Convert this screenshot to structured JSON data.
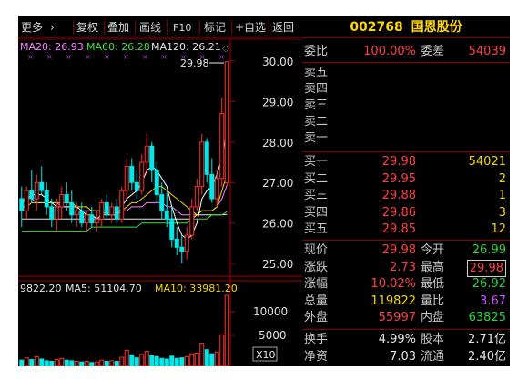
{
  "toolbar": {
    "more": "更多",
    "buttons": [
      "复权",
      "叠加",
      "画线",
      "F10",
      "标记",
      "+自选",
      "返回"
    ]
  },
  "ma_legend": [
    {
      "label": "MA20: 26.93",
      "color": "#ff80ff"
    },
    {
      "label": "MA60: 26.28",
      "color": "#3fe03f"
    },
    {
      "label": "MA120: 26.21",
      "color": "#e6e6e6"
    }
  ],
  "price_axis": [
    "30.00",
    "29.00",
    "28.00",
    "27.00",
    "26.00",
    "25.00"
  ],
  "high_marker": "29.98",
  "volume_legend": {
    "vol": "9822.20",
    "ma5": "MA5: 51104.70",
    "ma10": "MA10: 33981.20"
  },
  "volume_axis": [
    "10000",
    "5000"
  ],
  "volume_unit": "X10",
  "stock": {
    "code": "002768",
    "name": "国恩股份"
  },
  "order_ratio": {
    "label": "委比",
    "value": "100.00%",
    "label2": "委差",
    "value2": "54039"
  },
  "sell": [
    {
      "label": "卖五",
      "price": "",
      "vol": ""
    },
    {
      "label": "卖四",
      "price": "",
      "vol": ""
    },
    {
      "label": "卖三",
      "price": "",
      "vol": ""
    },
    {
      "label": "卖二",
      "price": "",
      "vol": ""
    },
    {
      "label": "卖一",
      "price": "",
      "vol": ""
    }
  ],
  "buy": [
    {
      "label": "买一",
      "price": "29.98",
      "vol": "54021"
    },
    {
      "label": "买二",
      "price": "29.95",
      "vol": "2"
    },
    {
      "label": "买三",
      "price": "29.88",
      "vol": "1"
    },
    {
      "label": "买四",
      "price": "29.86",
      "vol": "3"
    },
    {
      "label": "买五",
      "price": "29.85",
      "vol": "12"
    }
  ],
  "quote": [
    {
      "l1": "现价",
      "v1": "29.98",
      "l2": "今开",
      "v2": "26.99"
    },
    {
      "l1": "涨跌",
      "v1": "2.73",
      "l2": "最高",
      "v2": "29.98"
    },
    {
      "l1": "涨幅",
      "v1": "10.02%",
      "l2": "最低",
      "v2": "26.92"
    },
    {
      "l1": "总量",
      "v1": "119822",
      "l2": "量比",
      "v2": "3.67"
    },
    {
      "l1": "外盘",
      "v1": "55997",
      "l2": "内盘",
      "v2": "63825"
    }
  ],
  "stats": [
    {
      "l1": "换手",
      "v1": "4.99%",
      "l2": "股本",
      "v2": "2.71亿"
    },
    {
      "l1": "净资",
      "v1": "7.03",
      "l2": "流通",
      "v2": "2.40亿"
    }
  ],
  "chart_data": {
    "type": "candlestick",
    "ylim": [
      24.8,
      30.2
    ],
    "volume_ylim": [
      0,
      12000
    ],
    "candles": [
      [
        26.6,
        26.9,
        25.9,
        26.3,
        "down"
      ],
      [
        26.3,
        26.9,
        26.1,
        26.8,
        "up"
      ],
      [
        26.8,
        27.3,
        26.5,
        26.6,
        "down"
      ],
      [
        26.6,
        27.2,
        26.3,
        27.0,
        "up"
      ],
      [
        27.0,
        27.4,
        26.7,
        26.8,
        "down"
      ],
      [
        26.8,
        27.0,
        26.2,
        26.4,
        "down"
      ],
      [
        26.4,
        26.6,
        25.9,
        26.1,
        "down"
      ],
      [
        26.1,
        26.6,
        25.8,
        26.4,
        "up"
      ],
      [
        26.4,
        26.9,
        26.1,
        26.7,
        "up"
      ],
      [
        26.7,
        27.0,
        26.3,
        26.5,
        "down"
      ],
      [
        26.5,
        26.8,
        26.0,
        26.2,
        "down"
      ],
      [
        26.2,
        26.5,
        25.9,
        26.3,
        "up"
      ],
      [
        26.3,
        26.5,
        25.9,
        26.0,
        "down"
      ],
      [
        26.0,
        26.3,
        25.8,
        26.2,
        "up"
      ],
      [
        26.2,
        26.4,
        25.9,
        26.0,
        "down"
      ],
      [
        26.0,
        26.3,
        25.8,
        26.1,
        "up"
      ],
      [
        26.1,
        26.6,
        25.9,
        26.5,
        "up"
      ],
      [
        26.5,
        26.7,
        26.1,
        26.2,
        "down"
      ],
      [
        26.2,
        26.5,
        26.0,
        26.4,
        "up"
      ],
      [
        26.4,
        26.6,
        26.0,
        26.1,
        "down"
      ],
      [
        26.1,
        26.9,
        26.0,
        26.8,
        "up"
      ],
      [
        26.8,
        27.6,
        26.6,
        27.4,
        "up"
      ],
      [
        27.4,
        27.6,
        26.8,
        27.0,
        "down"
      ],
      [
        27.0,
        27.3,
        26.6,
        26.8,
        "down"
      ],
      [
        26.8,
        27.7,
        26.7,
        27.5,
        "up"
      ],
      [
        27.5,
        28.2,
        27.2,
        27.9,
        "up"
      ],
      [
        27.9,
        28.0,
        27.0,
        27.3,
        "down"
      ],
      [
        27.3,
        27.5,
        26.5,
        26.7,
        "down"
      ],
      [
        26.7,
        27.0,
        26.1,
        26.3,
        "down"
      ],
      [
        26.3,
        26.8,
        25.9,
        26.1,
        "down"
      ],
      [
        26.1,
        26.4,
        25.4,
        25.6,
        "down"
      ],
      [
        25.6,
        25.9,
        25.2,
        25.4,
        "down"
      ],
      [
        25.4,
        25.7,
        25.0,
        25.3,
        "down"
      ],
      [
        25.3,
        25.9,
        25.1,
        25.7,
        "up"
      ],
      [
        25.7,
        26.6,
        25.6,
        26.4,
        "up"
      ],
      [
        26.4,
        27.1,
        26.3,
        26.9,
        "up"
      ],
      [
        26.9,
        28.2,
        26.7,
        28.0,
        "up"
      ],
      [
        28.0,
        28.1,
        27.0,
        27.2,
        "down"
      ],
      [
        27.2,
        27.6,
        26.5,
        26.6,
        "down"
      ],
      [
        26.6,
        27.3,
        26.4,
        27.1,
        "up"
      ],
      [
        27.1,
        29.1,
        26.9,
        28.7,
        "up"
      ],
      [
        26.99,
        29.98,
        26.92,
        29.98,
        "up"
      ]
    ],
    "volumes": [
      [
        900,
        "down"
      ],
      [
        1300,
        "up"
      ],
      [
        1000,
        "down"
      ],
      [
        1500,
        "up"
      ],
      [
        1100,
        "down"
      ],
      [
        800,
        "down"
      ],
      [
        700,
        "down"
      ],
      [
        1000,
        "up"
      ],
      [
        1200,
        "up"
      ],
      [
        900,
        "down"
      ],
      [
        800,
        "down"
      ],
      [
        700,
        "up"
      ],
      [
        600,
        "down"
      ],
      [
        700,
        "up"
      ],
      [
        500,
        "down"
      ],
      [
        600,
        "up"
      ],
      [
        900,
        "up"
      ],
      [
        700,
        "down"
      ],
      [
        800,
        "up"
      ],
      [
        700,
        "down"
      ],
      [
        1400,
        "up"
      ],
      [
        2600,
        "up"
      ],
      [
        1800,
        "down"
      ],
      [
        1300,
        "down"
      ],
      [
        1900,
        "up"
      ],
      [
        2400,
        "up"
      ],
      [
        1700,
        "down"
      ],
      [
        1500,
        "down"
      ],
      [
        1200,
        "down"
      ],
      [
        1100,
        "down"
      ],
      [
        1600,
        "down"
      ],
      [
        1200,
        "down"
      ],
      [
        1300,
        "down"
      ],
      [
        1500,
        "up"
      ],
      [
        2000,
        "up"
      ],
      [
        2100,
        "up"
      ],
      [
        3800,
        "up"
      ],
      [
        2700,
        "down"
      ],
      [
        2000,
        "down"
      ],
      [
        2300,
        "up"
      ],
      [
        5200,
        "up"
      ],
      [
        11982,
        "up"
      ]
    ],
    "ma20": [
      26.6,
      26.6,
      26.6,
      26.5,
      26.5,
      26.5,
      26.5,
      26.5,
      26.4,
      26.4,
      26.4,
      26.4,
      26.3,
      26.3,
      26.3,
      26.3,
      26.3,
      26.3,
      26.3,
      26.3,
      26.3,
      26.3,
      26.4,
      26.4,
      26.4,
      26.5,
      26.5,
      26.5,
      26.5,
      26.4,
      26.4,
      26.3,
      26.2,
      26.2,
      26.2,
      26.2,
      26.3,
      26.3,
      26.3,
      26.4,
      26.6,
      26.93
    ],
    "ma60": [
      25.8,
      25.8,
      25.8,
      25.8,
      25.8,
      25.8,
      25.8,
      25.8,
      25.8,
      25.8,
      25.8,
      25.8,
      25.8,
      25.8,
      25.9,
      25.9,
      25.9,
      25.9,
      25.9,
      25.9,
      25.9,
      25.9,
      25.9,
      25.9,
      26.0,
      26.0,
      26.0,
      26.0,
      26.0,
      26.0,
      26.0,
      26.0,
      26.0,
      26.0,
      26.1,
      26.1,
      26.1,
      26.1,
      26.2,
      26.2,
      26.2,
      26.28
    ],
    "ma120": [
      26.1,
      26.1,
      26.1,
      26.1,
      26.1,
      26.1,
      26.1,
      26.1,
      26.1,
      26.1,
      26.1,
      26.1,
      26.1,
      26.1,
      26.1,
      26.1,
      26.1,
      26.1,
      26.1,
      26.1,
      26.1,
      26.1,
      26.1,
      26.1,
      26.1,
      26.1,
      26.1,
      26.1,
      26.1,
      26.1,
      26.1,
      26.1,
      26.1,
      26.1,
      26.1,
      26.2,
      26.2,
      26.2,
      26.2,
      26.2,
      26.2,
      26.21
    ],
    "ma5": [
      26.5,
      26.6,
      26.7,
      26.7,
      26.7,
      26.6,
      26.5,
      26.4,
      26.4,
      26.4,
      26.4,
      26.4,
      26.3,
      26.2,
      26.2,
      26.1,
      26.2,
      26.2,
      26.2,
      26.2,
      26.4,
      26.6,
      26.7,
      26.8,
      27.0,
      27.3,
      27.4,
      27.3,
      27.1,
      26.9,
      26.4,
      26.0,
      25.7,
      25.6,
      25.7,
      26.0,
      26.6,
      26.8,
      26.9,
      27.2,
      27.6,
      28.3
    ],
    "ma10": [
      26.4,
      26.4,
      26.5,
      26.5,
      26.5,
      26.5,
      26.5,
      26.5,
      26.5,
      26.5,
      26.5,
      26.4,
      26.4,
      26.4,
      26.3,
      26.3,
      26.3,
      26.2,
      26.2,
      26.2,
      26.3,
      26.4,
      26.5,
      26.5,
      26.6,
      26.7,
      26.8,
      26.9,
      26.9,
      26.8,
      26.7,
      26.6,
      26.5,
      26.4,
      26.3,
      26.2,
      26.3,
      26.3,
      26.3,
      26.4,
      26.8,
      27.2
    ]
  }
}
